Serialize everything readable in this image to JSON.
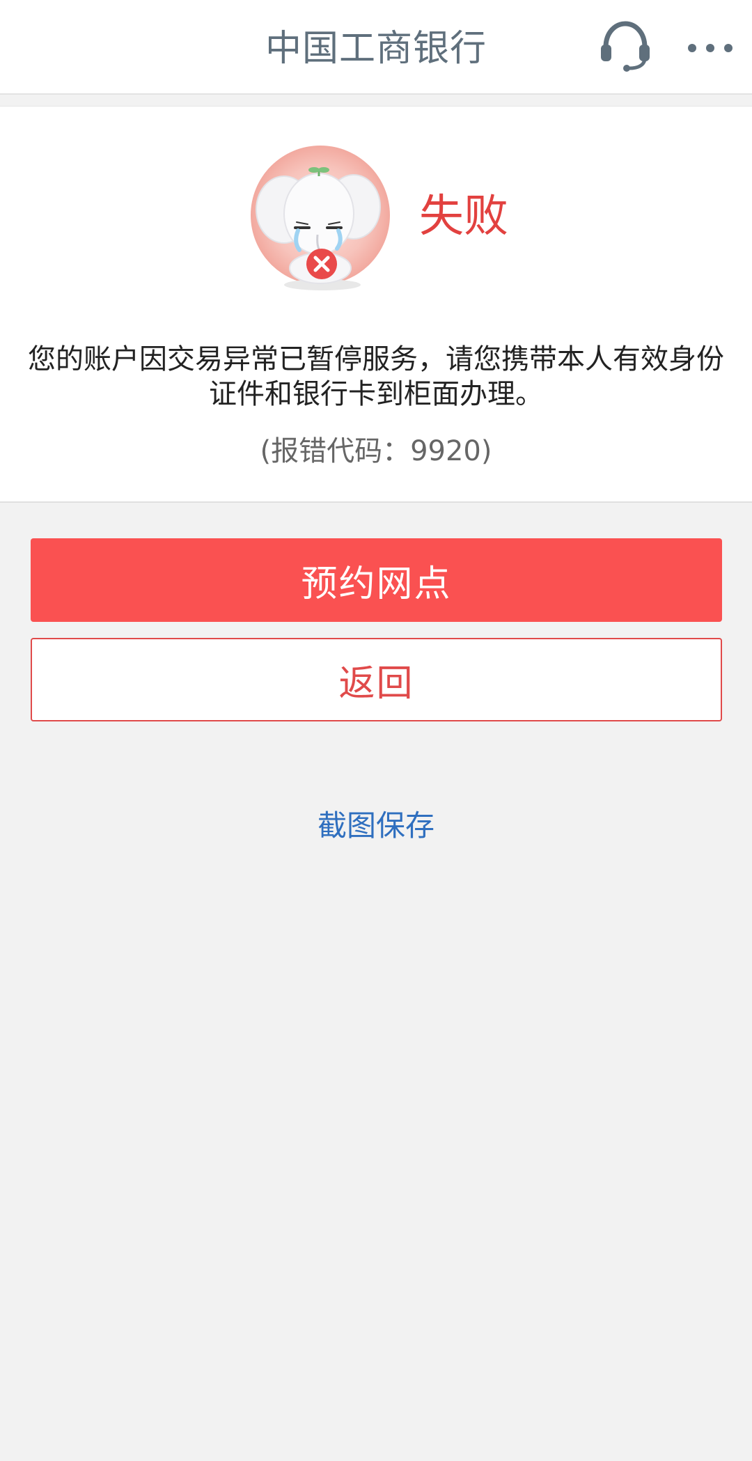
{
  "header": {
    "title": "中国工商银行",
    "service_icon": "headset-icon",
    "more_icon": "more-dots-icon"
  },
  "result": {
    "status": "失败",
    "mascot_icon": "crying-elephant-error-icon",
    "message": "您的账户因交易异常已暂停服务，请您携带本人有效身份证件和银行卡到柜面办理。",
    "error_code": "(报错代码：9920)"
  },
  "actions": {
    "primary_label": "预约网点",
    "secondary_label": "返回",
    "screenshot_label": "截图保存"
  },
  "colors": {
    "accent": "#fa5151",
    "status_red": "#e2413f",
    "link_blue": "#2f6fbf",
    "header_text": "#5f6f7c",
    "background": "#f2f2f2"
  }
}
